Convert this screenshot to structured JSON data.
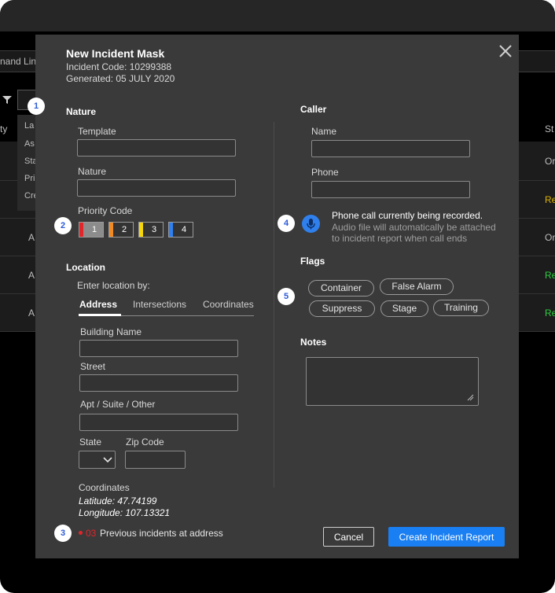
{
  "background": {
    "command_line": "nand Lin",
    "col_left_header": "ty",
    "col_right_header": "St",
    "dropdown_items": [
      "La",
      "As",
      "Sta",
      "Pri",
      "Cre"
    ],
    "rows": [
      {
        "left": "",
        "right": "Or",
        "right_color": "#e6e6e6"
      },
      {
        "left": "",
        "right": "Re",
        "right_color": "#d9b100"
      },
      {
        "left": "A",
        "right": "Or",
        "right_color": "#e6e6e6"
      },
      {
        "left": "A",
        "right": "Re",
        "right_color": "#2ecc40"
      },
      {
        "left": "A",
        "right": "Re",
        "right_color": "#2ecc40"
      }
    ]
  },
  "modal": {
    "title": "New Incident Mask",
    "incident_code": "Incident Code: 10299388",
    "generated": "Generated:  05 JULY 2020"
  },
  "nature": {
    "heading": "Nature",
    "template_label": "Template",
    "nature_label": "Nature",
    "priority_label": "Priority Code",
    "priorities": [
      {
        "label": "1",
        "color": "#e0262b",
        "selected": true
      },
      {
        "label": "2",
        "color": "#f08a24",
        "selected": false
      },
      {
        "label": "3",
        "color": "#f5d50c",
        "selected": false
      },
      {
        "label": "4",
        "color": "#2f7ff0",
        "selected": false
      }
    ]
  },
  "location": {
    "heading": "Location",
    "enter_by": "Enter location by:",
    "tabs": [
      "Address",
      "Intersections",
      "Coordinates"
    ],
    "active_tab": "Address",
    "building_label": "Building Name",
    "street_label": "Street",
    "apt_label": "Apt / Suite / Other",
    "state_label": "State",
    "zip_label": "Zip Code",
    "coords_label": "Coordinates",
    "latitude": "Latitude: 47.74199",
    "longitude": "Longitude: 107.13321",
    "prev_count": "03",
    "prev_text": "Previous incidents at address"
  },
  "caller": {
    "heading": "Caller",
    "name_label": "Name",
    "phone_label": "Phone",
    "recording_title": "Phone call currently being recorded.",
    "recording_line1": "Audio file will automatically be attached",
    "recording_line2": "to incident report when call ends"
  },
  "flags": {
    "heading": "Flags",
    "items": [
      "Container",
      "False Alarm",
      "Suppress",
      "Stage",
      "Training"
    ]
  },
  "notes": {
    "heading": "Notes"
  },
  "buttons": {
    "cancel": "Cancel",
    "create": "Create Incident Report"
  },
  "badges": [
    "1",
    "2",
    "3",
    "4",
    "5"
  ],
  "colors": {
    "accent": "#1a7ff2",
    "alert_red": "#e0262b",
    "modal_bg": "#3a3a3a"
  }
}
